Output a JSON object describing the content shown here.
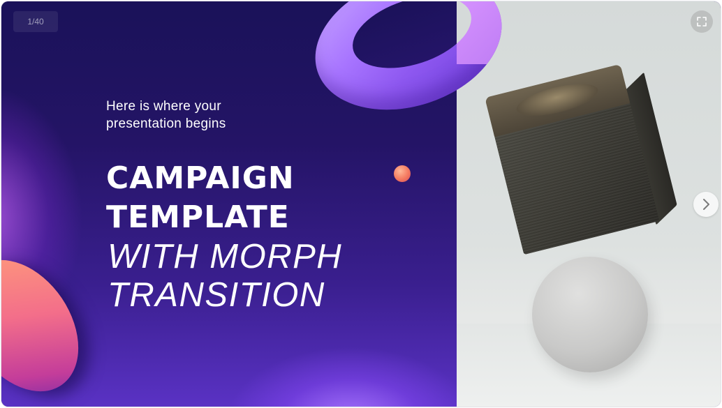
{
  "slide": {
    "counter": "1/40",
    "subtitle_line1": "Here is where your",
    "subtitle_line2": "presentation begins",
    "title_line1": "CAMPAIGN",
    "title_line2": "TEMPLATE",
    "title_line3": "WITH MORPH",
    "title_line4": "TRANSITION"
  },
  "controls": {
    "fullscreen_icon": "fullscreen-icon",
    "next_icon": "chevron-right-icon"
  },
  "colors": {
    "background_dark": "#1a1259",
    "accent_purple": "#a774ff",
    "text": "#ffffff",
    "right_panel": "#d5dad9"
  }
}
